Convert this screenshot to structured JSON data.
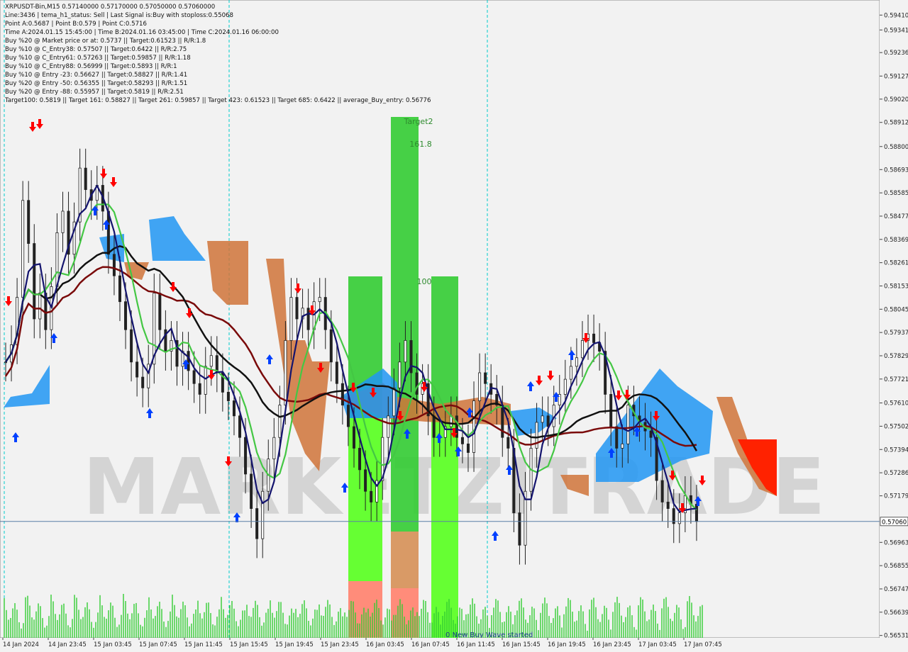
{
  "header": {
    "lines": [
      "XRPUSDT-Bin,M15  0.57140000 0.57170000 0.57050000 0.57060000",
      "Line:3436 | tema_h1_status: Sell | Last Signal is:Buy with stoploss:0.55068",
      "Point A:0.5687 | Point B:0.579 | Point C:0.5716",
      "Time A:2024.01.15 15:45:00 | Time B:2024.01.16 03:45:00 | Time C:2024.01.16 06:00:00",
      "Buy %20 @ Market price or at: 0.5737 || Target:0.61523 || R/R:1.8",
      "Buy %10 @ C_Entry38: 0.57507 || Target:0.6422 || R/R:2.75",
      "Buy %10 @ C_Entry61: 0.57263 || Target:0.59857 || R/R:1.18",
      "Buy %10 @ C_Entry88: 0.56999 || Target:0.5893 || R/R:1",
      "Buy %10 @ Entry -23: 0.56627 || Target:0.58827 || R/R:1.41",
      "Buy %20 @ Entry -50: 0.56355 || Target:0.58293 || R/R:1.51",
      "Buy %20 @ Entry -88: 0.55957 || Target:0.5819 || R/R:2.51",
      "Target100: 0.5819 || Target 161: 0.58827 || Target 261: 0.59857 || Target 423: 0.61523 || Target 685: 0.6422 || average_Buy_entry: 0.56776"
    ]
  },
  "labels": {
    "target2": "Target2",
    "fib161": "161.8",
    "fib100": "100",
    "wave": "0 New Buy Wave started",
    "watermark": "MARKETZITRADE"
  },
  "colors": {
    "background": "#f2f2f2",
    "axis_text": "#222222",
    "price_line": "#5b7fa6",
    "green_bar": "#33cc33",
    "lime_bar": "#66ff33",
    "salmon": "#ff8c7a",
    "tan": "#d99a66",
    "cloud_orange": "#d0743a",
    "cloud_blue": "#2196f3",
    "ma_black": "#111111",
    "ma_maroon": "#7a0a0a",
    "ma_navy": "#14146e",
    "ma_green": "#44c744",
    "candle": "#222222",
    "volume": "#33cc33",
    "red_arrow": "#ff0000",
    "blue_arrow": "#0040ff",
    "vline": "#00cccc"
  },
  "chart_data": {
    "type": "candlestick",
    "symbol": "XRPUSDT-Bin",
    "timeframe": "M15",
    "ohlc_last": {
      "open": 0.5714,
      "high": 0.5717,
      "low": 0.5705,
      "close": 0.5706
    },
    "current_price": 0.5706,
    "current_price_label": "0.57060",
    "ylim": [
      0.5652,
      0.5948
    ],
    "y_ticks": [
      "0.59410",
      "0.59341",
      "0.59236",
      "0.59127",
      "0.59020",
      "0.58912",
      "0.58800",
      "0.58693",
      "0.58585",
      "0.58477",
      "0.58369",
      "0.58261",
      "0.58153",
      "0.58045",
      "0.57937",
      "0.57829",
      "0.57721",
      "0.57610",
      "0.57502",
      "0.57394",
      "0.57286",
      "0.57179",
      "0.56963",
      "0.56855",
      "0.56747",
      "0.56639",
      "0.56531"
    ],
    "x_ticks": [
      "14 Jan 2024",
      "14 Jan 23:45",
      "15 Jan 03:45",
      "15 Jan 07:45",
      "15 Jan 11:45",
      "15 Jan 15:45",
      "15 Jan 19:45",
      "15 Jan 23:45",
      "16 Jan 03:45",
      "16 Jan 07:45",
      "16 Jan 11:45",
      "16 Jan 15:45",
      "16 Jan 19:45",
      "16 Jan 23:45",
      "17 Jan 03:45",
      "17 Jan 07:45"
    ],
    "vlines_time": [
      "2024.01.15 15:45:00",
      "2024.01.16 06:00:00"
    ],
    "close_series": [
      0.578,
      0.5788,
      0.581,
      0.5855,
      0.5835,
      0.58,
      0.5812,
      0.5795,
      0.5815,
      0.584,
      0.585,
      0.583,
      0.5845,
      0.587,
      0.586,
      0.5855,
      0.5862,
      0.585,
      0.583,
      0.582,
      0.5808,
      0.5795,
      0.578,
      0.5773,
      0.5768,
      0.5779,
      0.5812,
      0.5795,
      0.5785,
      0.579,
      0.5778,
      0.5785,
      0.5776,
      0.577,
      0.5765,
      0.5778,
      0.5783,
      0.5775,
      0.5766,
      0.5762,
      0.5755,
      0.5745,
      0.5728,
      0.5712,
      0.5698,
      0.572,
      0.5735,
      0.5745,
      0.576,
      0.579,
      0.581,
      0.58,
      0.5805,
      0.5795,
      0.5808,
      0.581,
      0.5795,
      0.578,
      0.577,
      0.576,
      0.575,
      0.574,
      0.573,
      0.572,
      0.5715,
      0.5725,
      0.5745,
      0.5755,
      0.5768,
      0.578,
      0.579,
      0.5775,
      0.5765,
      0.577,
      0.5755,
      0.5745,
      0.5745,
      0.575,
      0.5755,
      0.5745,
      0.5742,
      0.5738,
      0.5762,
      0.5775,
      0.577,
      0.5765,
      0.576,
      0.5745,
      0.574,
      0.571,
      0.5695,
      0.572,
      0.574,
      0.5752,
      0.5755,
      0.575,
      0.576,
      0.5765,
      0.5772,
      0.5778,
      0.5782,
      0.579,
      0.5793,
      0.5789,
      0.5785,
      0.5765,
      0.575,
      0.574,
      0.5742,
      0.576,
      0.5755,
      0.5752,
      0.5748,
      0.5745,
      0.5725,
      0.5715,
      0.5712,
      0.5705,
      0.571,
      0.5718,
      0.5714,
      0.5706
    ]
  }
}
